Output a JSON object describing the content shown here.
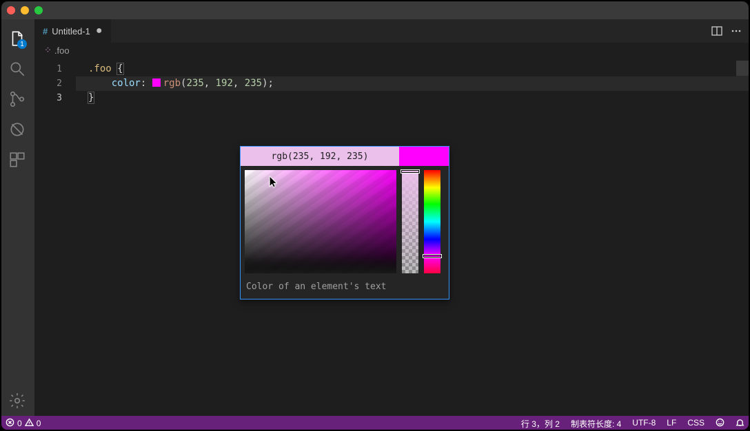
{
  "activity": {
    "badge": "1"
  },
  "tab": {
    "title": "Untitled-1"
  },
  "breadcrumb": {
    "item": ".foo"
  },
  "code": {
    "line_numbers": [
      "1",
      "2",
      "3"
    ],
    "l1_selector": ".foo",
    "l1_brace_open": "{",
    "l2_indent": "    ",
    "l2_prop": "color",
    "l2_colon": ": ",
    "l2_func": "rgb",
    "l2_open": "(",
    "l2_a": "235",
    "l2_c1": ", ",
    "l2_b": "192",
    "l2_c2": ", ",
    "l2_c": "235",
    "l2_close": ")",
    "l2_semi": ";",
    "l3_brace_close": "}"
  },
  "colorpicker": {
    "title": "rgb(235, 192, 235)",
    "hint": "Color of an element's text",
    "current_hex": "#ff00ff",
    "selected_hex": "#ebc0eb"
  },
  "status": {
    "errors": "0",
    "warnings": "0",
    "ln_col": "行 3，列 2",
    "indent": "制表符长度: 4",
    "encoding": "UTF-8",
    "eol": "LF",
    "lang": "CSS"
  }
}
